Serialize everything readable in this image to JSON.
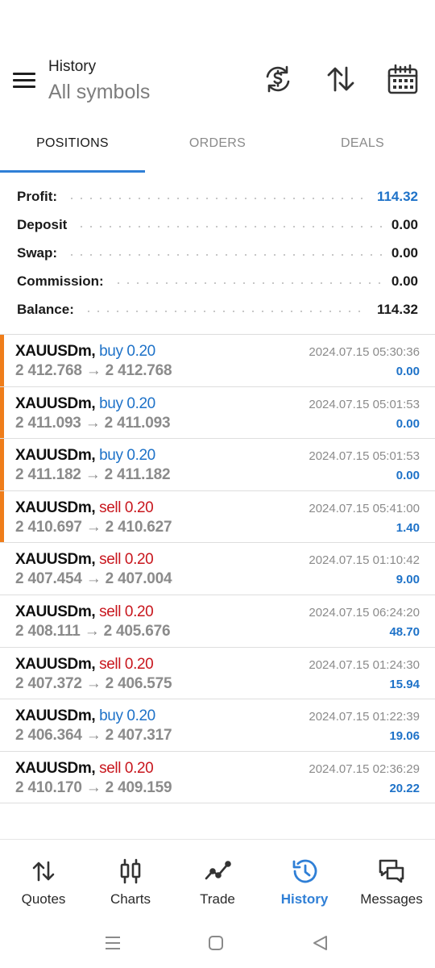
{
  "header": {
    "title": "History",
    "subtitle": "All symbols",
    "icons": [
      "menu-icon",
      "currency-exchange-icon",
      "sort-arrows-icon",
      "calendar-icon"
    ]
  },
  "tabs": [
    {
      "label": "POSITIONS",
      "active": true
    },
    {
      "label": "ORDERS",
      "active": false
    },
    {
      "label": "DEALS",
      "active": false
    }
  ],
  "summary": [
    {
      "label": "Profit:",
      "value": "114.32",
      "highlight": true
    },
    {
      "label": "Deposit",
      "value": "0.00",
      "highlight": false
    },
    {
      "label": "Swap:",
      "value": "0.00",
      "highlight": false
    },
    {
      "label": "Commission:",
      "value": "0.00",
      "highlight": false
    },
    {
      "label": "Balance:",
      "value": "114.32",
      "highlight": false
    }
  ],
  "deals": [
    {
      "symbol": "XAUUSDm,",
      "side": "buy 0.20",
      "type": "buy",
      "prices": "2 412.768 → 2 412.768",
      "time": "2024.07.15 05:30:36",
      "profit": "0.00",
      "marked": true
    },
    {
      "symbol": "XAUUSDm,",
      "side": "buy 0.20",
      "type": "buy",
      "prices": "2 411.093 → 2 411.093",
      "time": "2024.07.15 05:01:53",
      "profit": "0.00",
      "marked": true
    },
    {
      "symbol": "XAUUSDm,",
      "side": "buy 0.20",
      "type": "buy",
      "prices": "2 411.182 → 2 411.182",
      "time": "2024.07.15 05:01:53",
      "profit": "0.00",
      "marked": true
    },
    {
      "symbol": "XAUUSDm,",
      "side": "sell 0.20",
      "type": "sell",
      "prices": "2 410.697 → 2 410.627",
      "time": "2024.07.15 05:41:00",
      "profit": "1.40",
      "marked": true
    },
    {
      "symbol": "XAUUSDm,",
      "side": "sell 0.20",
      "type": "sell",
      "prices": "2 407.454 → 2 407.004",
      "time": "2024.07.15 01:10:42",
      "profit": "9.00",
      "marked": false
    },
    {
      "symbol": "XAUUSDm,",
      "side": "sell 0.20",
      "type": "sell",
      "prices": "2 408.111 → 2 405.676",
      "time": "2024.07.15 06:24:20",
      "profit": "48.70",
      "marked": false
    },
    {
      "symbol": "XAUUSDm,",
      "side": "sell 0.20",
      "type": "sell",
      "prices": "2 407.372 → 2 406.575",
      "time": "2024.07.15 01:24:30",
      "profit": "15.94",
      "marked": false
    },
    {
      "symbol": "XAUUSDm,",
      "side": "buy 0.20",
      "type": "buy",
      "prices": "2 406.364 → 2 407.317",
      "time": "2024.07.15 01:22:39",
      "profit": "19.06",
      "marked": false
    },
    {
      "symbol": "XAUUSDm,",
      "side": "sell 0.20",
      "type": "sell",
      "prices": "2 410.170 → 2 409.159",
      "time": "2024.07.15 02:36:29",
      "profit": "20.22",
      "marked": false
    }
  ],
  "nav": [
    {
      "label": "Quotes",
      "icon": "quotes-arrows-icon",
      "active": false
    },
    {
      "label": "Charts",
      "icon": "candlestick-chart-icon",
      "active": false
    },
    {
      "label": "Trade",
      "icon": "trade-line-icon",
      "active": false
    },
    {
      "label": "History",
      "icon": "history-clock-icon",
      "active": true
    },
    {
      "label": "Messages",
      "icon": "messages-bubbles-icon",
      "active": false
    }
  ],
  "system_bar": [
    "recent-apps-icon",
    "home-icon",
    "back-icon"
  ],
  "colors": {
    "accent": "#2f7fd6",
    "buy": "#1e72c8",
    "sell": "#c8161d",
    "marker": "#ef7d1a",
    "muted": "#8b8b8b"
  }
}
